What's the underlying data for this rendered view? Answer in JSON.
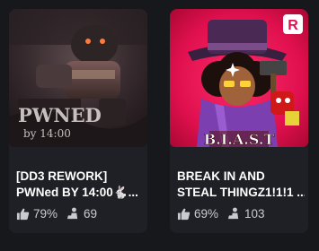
{
  "games": [
    {
      "title_line1": "[DD3 REWORK]",
      "title_line2": "PWNed BY 14:00🐇...",
      "rating": "79%",
      "players": "69",
      "thumb_caption_main": "PWNED",
      "thumb_caption_sub": "by 14:00"
    },
    {
      "title_line1": "BREAK IN AND",
      "title_line2": "STEAL THINGZ1!1!1 ...",
      "rating": "69%",
      "players": "103",
      "thumb_logo_text": "B.I.A.S.T",
      "thumb_badge": "R"
    }
  ],
  "icons": {
    "rating": "thumbs-up-icon",
    "players": "players-icon"
  }
}
